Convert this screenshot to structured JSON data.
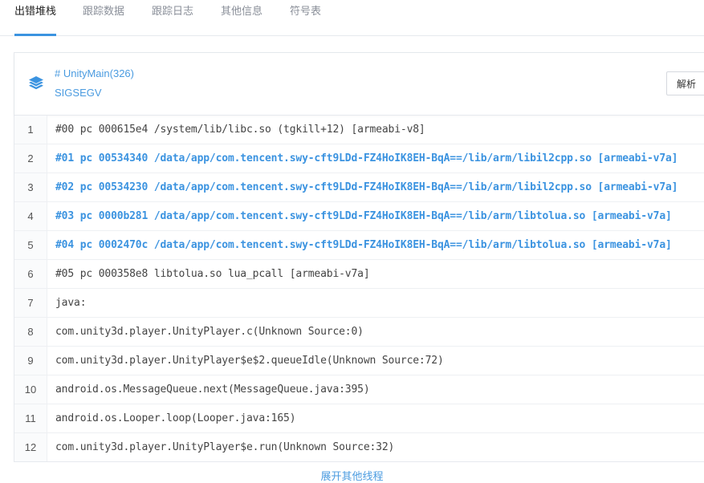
{
  "tabs": [
    {
      "label": "出错堆栈",
      "active": true
    },
    {
      "label": "跟踪数据",
      "active": false
    },
    {
      "label": "跟踪日志",
      "active": false
    },
    {
      "label": "其他信息",
      "active": false
    },
    {
      "label": "符号表",
      "active": false
    }
  ],
  "thread": {
    "icon": "layers-icon",
    "name": "# UnityMain(326)",
    "signal": "SIGSEGV",
    "parse_button": "解析"
  },
  "frames": [
    {
      "no": "1",
      "text": "#00 pc 000615e4 /system/lib/libc.so (tgkill+12) [armeabi-v8]",
      "highlight": false
    },
    {
      "no": "2",
      "text": "#01 pc 00534340 /data/app/com.tencent.swy-cft9LDd-FZ4HoIK8EH-BqA==/lib/arm/libil2cpp.so [armeabi-v7a]",
      "highlight": true
    },
    {
      "no": "3",
      "text": "#02 pc 00534230 /data/app/com.tencent.swy-cft9LDd-FZ4HoIK8EH-BqA==/lib/arm/libil2cpp.so [armeabi-v7a]",
      "highlight": true
    },
    {
      "no": "4",
      "text": "#03 pc 0000b281 /data/app/com.tencent.swy-cft9LDd-FZ4HoIK8EH-BqA==/lib/arm/libtolua.so [armeabi-v7a]",
      "highlight": true
    },
    {
      "no": "5",
      "text": "#04 pc 0002470c /data/app/com.tencent.swy-cft9LDd-FZ4HoIK8EH-BqA==/lib/arm/libtolua.so [armeabi-v7a]",
      "highlight": true
    },
    {
      "no": "6",
      "text": "#05 pc 000358e8 libtolua.so lua_pcall [armeabi-v7a]",
      "highlight": false
    },
    {
      "no": "7",
      "text": "java:",
      "highlight": false
    },
    {
      "no": "8",
      "text": "com.unity3d.player.UnityPlayer.c(Unknown Source:0)",
      "highlight": false
    },
    {
      "no": "9",
      "text": "com.unity3d.player.UnityPlayer$e$2.queueIdle(Unknown Source:72)",
      "highlight": false
    },
    {
      "no": "10",
      "text": "android.os.MessageQueue.next(MessageQueue.java:395)",
      "highlight": false
    },
    {
      "no": "11",
      "text": "android.os.Looper.loop(Looper.java:165)",
      "highlight": false
    },
    {
      "no": "12",
      "text": "com.unity3d.player.UnityPlayer$e.run(Unknown Source:32)",
      "highlight": false
    }
  ],
  "expand_link": "展开其他线程",
  "colors": {
    "accent": "#3b93e0",
    "highlight_text": "#3b93e0",
    "normal_text": "#444444"
  }
}
